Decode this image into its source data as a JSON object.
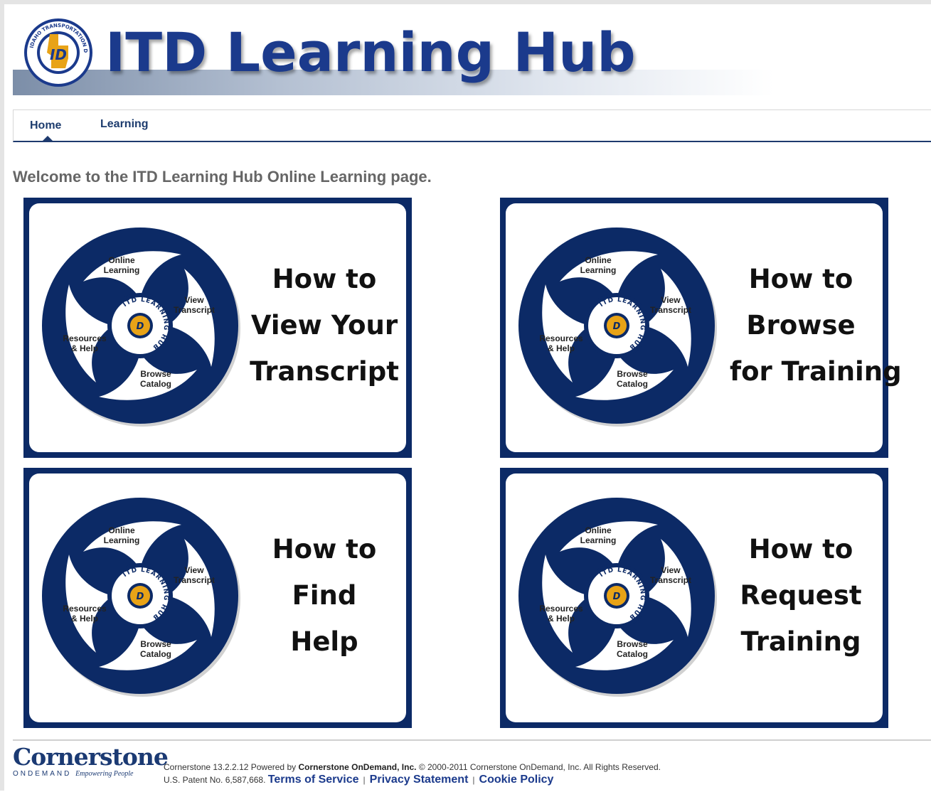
{
  "header": {
    "title": "ITD Learning Hub",
    "seal_text": "IDAHO TRANSPORTATION DEPARTMENT"
  },
  "nav": {
    "tabs": [
      {
        "label": "Home",
        "active": true
      },
      {
        "label": "Learning",
        "active": false
      }
    ]
  },
  "main": {
    "welcome": "Welcome to the ITD Learning Hub Online Learning page.",
    "wheel_labels": {
      "online": [
        "Online",
        "Learning"
      ],
      "transcript": [
        "View",
        "Transcript"
      ],
      "resources": [
        "Resources",
        "& Help"
      ],
      "catalog": [
        "Browse",
        "Catalog"
      ],
      "hub": "ITD LEARNING HUB"
    },
    "tiles": [
      {
        "lines": [
          "How to",
          "View Your",
          "Transcript"
        ]
      },
      {
        "lines": [
          "How to",
          "Browse",
          "for Training"
        ]
      },
      {
        "lines": [
          "How to",
          "Find",
          "Help"
        ]
      },
      {
        "lines": [
          "How to",
          "Request",
          "Training"
        ]
      }
    ]
  },
  "footer": {
    "logo_word": "Cornerstone",
    "logo_sub": "ONDEMAND",
    "logo_tagline": "Empowering People",
    "line1_prefix": "Cornerstone 13.2.2.12 Powered by ",
    "line1_company": "Cornerstone OnDemand, Inc.",
    "line1_suffix": " © 2000-2011 Cornerstone OnDemand, Inc. All Rights Reserved.",
    "patent": "U.S. Patent No. 6,587,668.",
    "links": {
      "terms": "Terms of Service",
      "privacy": "Privacy Statement",
      "cookie": "Cookie Policy"
    }
  },
  "colors": {
    "navy": "#0c2a66",
    "brand_blue": "#1b3a8c",
    "seal_orange": "#e8a317"
  }
}
